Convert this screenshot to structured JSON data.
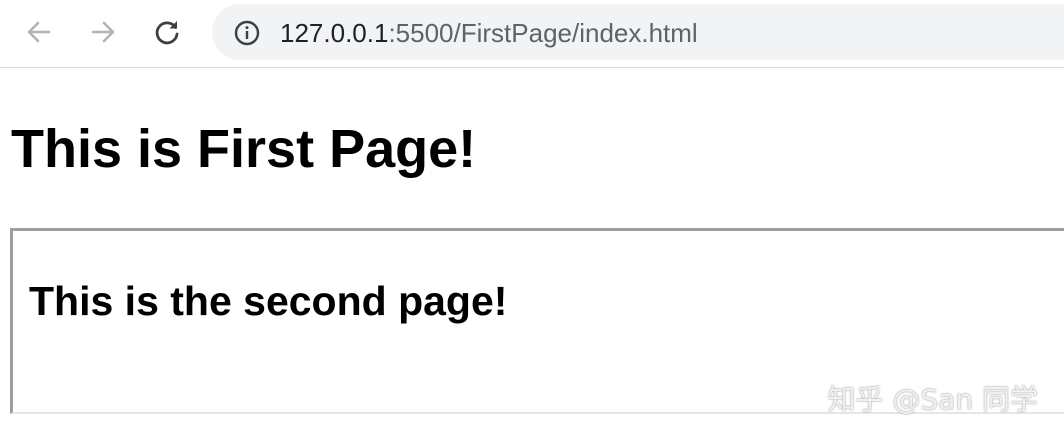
{
  "browser": {
    "back_icon": "arrow-left-icon",
    "forward_icon": "arrow-right-icon",
    "reload_icon": "reload-icon",
    "site_info_icon": "info-circle-icon",
    "url_host": "127.0.0.1",
    "url_path": ":5500/FirstPage/index.html"
  },
  "page": {
    "heading": "This is First Page!"
  },
  "iframe": {
    "heading": "This is the second page!"
  },
  "watermark": {
    "text": "知乎 @San 同学"
  },
  "colors": {
    "toolbar_bg": "#ffffff",
    "address_bar_bg": "#f1f3f4",
    "icon_disabled": "#b0b3b8",
    "icon_enabled": "#3c4043",
    "iframe_border": "#9e9e9e"
  }
}
